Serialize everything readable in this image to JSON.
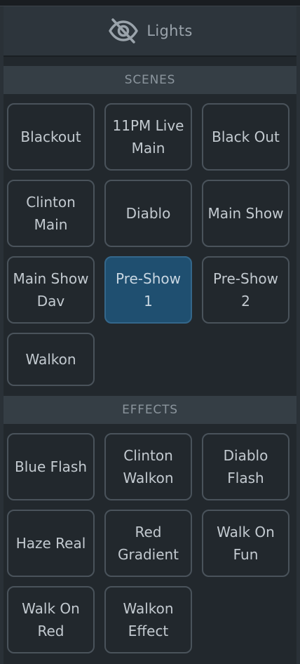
{
  "header": {
    "title": "Lights",
    "icon": "eye-off-icon"
  },
  "sections": {
    "scenes": {
      "label": "SCENES",
      "items": [
        {
          "label": "Blackout",
          "active": false
        },
        {
          "label": "11PM Live Main",
          "active": false
        },
        {
          "label": "Black Out",
          "active": false
        },
        {
          "label": "Clinton Main",
          "active": false
        },
        {
          "label": "Diablo",
          "active": false
        },
        {
          "label": "Main Show",
          "active": false
        },
        {
          "label": "Main Show Dav",
          "active": false
        },
        {
          "label": "Pre-Show 1",
          "active": true
        },
        {
          "label": "Pre-Show 2",
          "active": false
        },
        {
          "label": "Walkon",
          "active": false
        }
      ]
    },
    "effects": {
      "label": "EFFECTS",
      "items": [
        {
          "label": "Blue Flash",
          "active": false
        },
        {
          "label": "Clinton Walkon",
          "active": false
        },
        {
          "label": "Diablo Flash",
          "active": false
        },
        {
          "label": "Haze Real",
          "active": false
        },
        {
          "label": "Red Gradient",
          "active": false
        },
        {
          "label": "Walk On Fun",
          "active": false
        },
        {
          "label": "Walk On Red",
          "active": false
        },
        {
          "label": "Walkon Effect",
          "active": false
        }
      ]
    }
  },
  "colors": {
    "active_tile": "#1f4f70",
    "tile_border": "#4a535b",
    "background": "#22282d"
  }
}
